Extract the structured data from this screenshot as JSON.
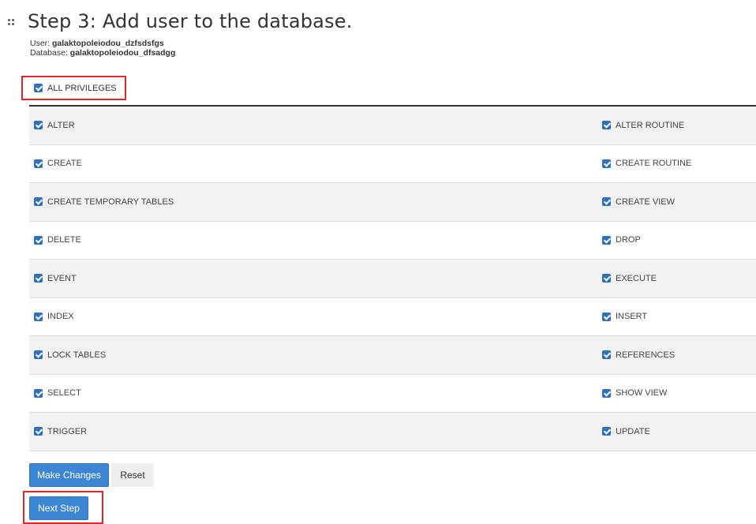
{
  "header": {
    "title": "Step 3: Add user to the database.",
    "user_label": "User:",
    "user_value": "galaktopoleiodou_dzfsdsfgs",
    "db_label": "Database:",
    "db_value": "galaktopoleiodou_dfsadgg"
  },
  "all_privileges": {
    "label": "ALL PRIVILEGES",
    "checked": true
  },
  "privileges": [
    {
      "left": "ALTER",
      "right": "ALTER ROUTINE"
    },
    {
      "left": "CREATE",
      "right": "CREATE ROUTINE"
    },
    {
      "left": "CREATE TEMPORARY TABLES",
      "right": "CREATE VIEW"
    },
    {
      "left": "DELETE",
      "right": "DROP"
    },
    {
      "left": "EVENT",
      "right": "EXECUTE"
    },
    {
      "left": "INDEX",
      "right": "INSERT"
    },
    {
      "left": "LOCK TABLES",
      "right": "REFERENCES"
    },
    {
      "left": "SELECT",
      "right": "SHOW VIEW"
    },
    {
      "left": "TRIGGER",
      "right": "UPDATE"
    }
  ],
  "buttons": {
    "make_changes": "Make Changes",
    "reset": "Reset",
    "next_step": "Next Step"
  },
  "colors": {
    "accent": "#3d86d4",
    "highlight": "#e0262b",
    "checkbox": "#2f6fb7"
  }
}
